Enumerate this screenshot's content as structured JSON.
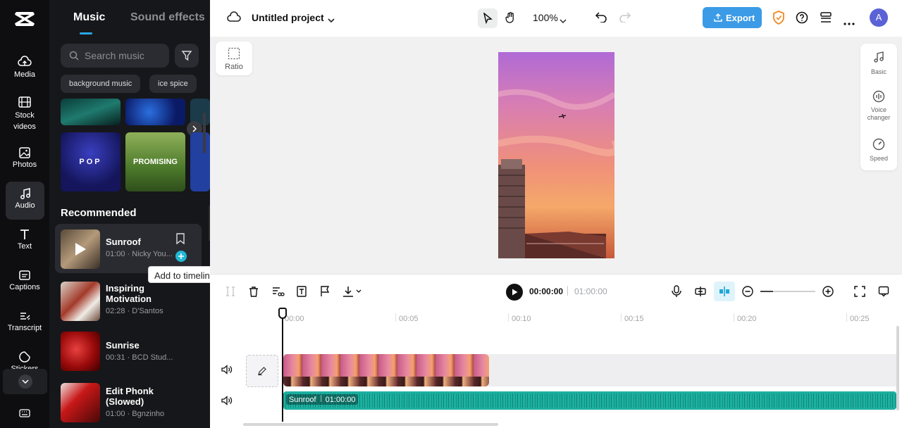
{
  "rail": {
    "items": [
      {
        "label": "Media"
      },
      {
        "label": "Stock videos"
      },
      {
        "label": "Photos"
      },
      {
        "label": "Audio"
      },
      {
        "label": "Text"
      },
      {
        "label": "Captions"
      },
      {
        "label": "Transcript"
      },
      {
        "label": "Stickers"
      }
    ]
  },
  "panel": {
    "tabs": [
      "Music",
      "Sound effects"
    ],
    "search_placeholder": "Search music",
    "chips": [
      "background music",
      "ice spice"
    ],
    "cards": [
      "POP",
      "PROMISING"
    ],
    "section_title": "Recommended",
    "tooltip": "Add to timeline",
    "tracks": [
      {
        "title": "Sunroof",
        "meta": "01:00 · Nicky You..."
      },
      {
        "title": "Inspiring Motivation",
        "meta": "02:28 · D'Santos"
      },
      {
        "title": "Sunrise",
        "meta": "00:31 · BCD Stud..."
      },
      {
        "title": "Edit Phonk (Slowed)",
        "meta": "01:00 · Bgnzinho"
      }
    ]
  },
  "topbar": {
    "project_title": "Untitled project",
    "zoom": "100%",
    "export_label": "Export",
    "avatar_letter": "A"
  },
  "canvas": {
    "ratio_label": "Ratio",
    "side_panel": [
      "Basic",
      "Voice changer",
      "Speed"
    ]
  },
  "toolbar": {
    "current_time": "00:00:00",
    "total_time": "01:00:00"
  },
  "timeline": {
    "ticks": [
      "00:00",
      "00:05",
      "00:10",
      "00:15",
      "00:20",
      "00:25"
    ],
    "audio_clip_name": "Sunroof",
    "audio_clip_time": "01:00:00"
  },
  "colors": {
    "accent": "#2aa5e8",
    "export_bg": "#3b9be6",
    "audio_track": "#1db0a0",
    "dark_panel": "#16171a"
  }
}
